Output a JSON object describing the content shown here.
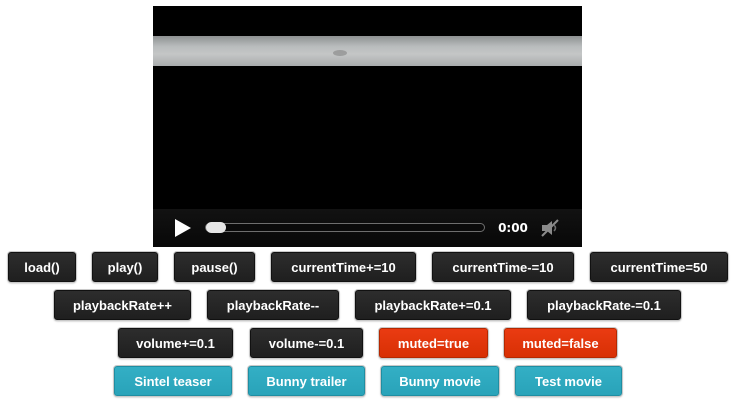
{
  "player": {
    "time": "0:00",
    "progress": 0,
    "play_icon": "play-icon",
    "mute_icon": "speaker-muted-icon"
  },
  "buttons": {
    "row1": [
      "load()",
      "play()",
      "pause()",
      "currentTime+=10",
      "currentTime-=10",
      "currentTime=50"
    ],
    "row2": [
      "playbackRate++",
      "playbackRate--",
      "playbackRate+=0.1",
      "playbackRate-=0.1"
    ],
    "row3": [
      "volume+=0.1",
      "volume-=0.1",
      "muted=true",
      "muted=false"
    ],
    "row4": [
      "Sintel teaser",
      "Bunny trailer",
      "Bunny movie",
      "Test movie"
    ]
  },
  "colors": {
    "dark": "#222222",
    "red": "#e03508",
    "teal": "#2fa9bf"
  }
}
